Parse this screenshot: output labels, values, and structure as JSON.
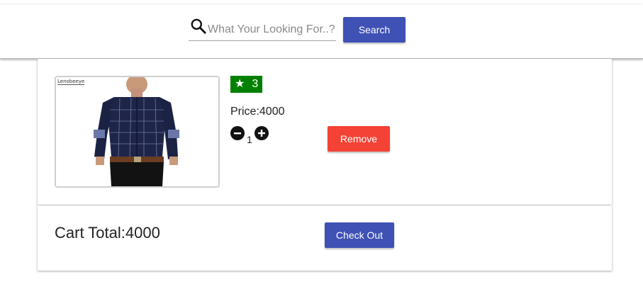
{
  "search": {
    "placeholder": "What Your Looking For..?",
    "button_label": "Search"
  },
  "cart_item": {
    "brand_text": "Lenobeeye",
    "rating": "3",
    "price_label": "Price:",
    "price_value": "4000",
    "quantity": "1",
    "remove_label": "Remove"
  },
  "summary": {
    "total_label": "Cart Total:",
    "total_value": "4000",
    "checkout_label": "Check Out"
  },
  "colors": {
    "primary": "#3f51b5",
    "danger": "#f44336",
    "rating_bg": "#008000"
  },
  "icons": [
    "search-icon",
    "star-icon",
    "minus-circle-icon",
    "plus-circle-icon"
  ]
}
